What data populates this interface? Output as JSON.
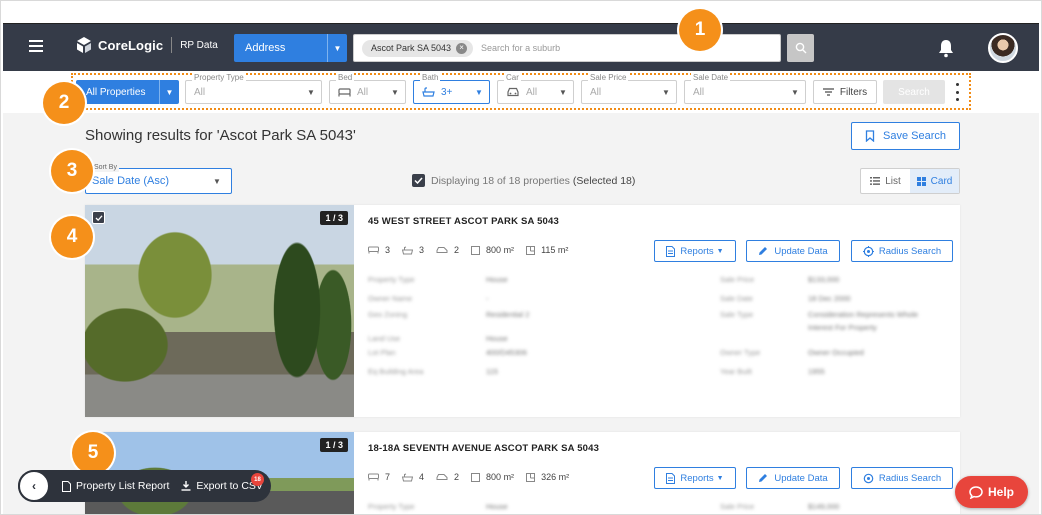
{
  "topnav": {
    "brand": "CoreLogic",
    "product": "RP Data",
    "address_select": "Address",
    "search_chip": "Ascot Park SA 5043",
    "search_placeholder": "Search for a suburb"
  },
  "filters": {
    "all_properties": "All Properties",
    "property_type": {
      "label": "Property Type",
      "value": "All"
    },
    "bed": {
      "label": "Bed",
      "value": "All"
    },
    "bath": {
      "label": "Bath",
      "value": "3+"
    },
    "car": {
      "label": "Car",
      "value": "All"
    },
    "sale_price": {
      "label": "Sale Price",
      "value": "All"
    },
    "sale_date": {
      "label": "Sale Date",
      "value": "All"
    },
    "filters_button": "Filters",
    "search_button": "Search"
  },
  "results": {
    "title": "Showing results for 'Ascot Park SA 5043'",
    "save_search": "Save Search",
    "sort_label": "Sort By",
    "sort_value": "Sale Date (Asc)",
    "displaying": "Displaying 18 of 18 properties",
    "selected": "(Selected 18)",
    "view_list": "List",
    "view_card": "Card"
  },
  "cards": [
    {
      "counter": "1 / 3",
      "address": "45 WEST STREET ASCOT PARK SA 5043",
      "beds": "3",
      "baths": "3",
      "cars": "2",
      "land": "800 m²",
      "floor": "115 m²",
      "reports": "Reports",
      "update": "Update Data",
      "radius": "Radius Search",
      "details": [
        [
          "Property Type",
          "House",
          "Sale Price",
          "$133,000"
        ],
        [
          "Owner Name",
          "-",
          "Sale Date",
          "18 Dec 2000"
        ],
        [
          "Geo Zoning",
          "Residential 2",
          "Sale Type",
          "Consideration Represents Whole"
        ],
        [
          "",
          "",
          "",
          "Interest For Property"
        ],
        [
          "Land Use",
          "House",
          "",
          ""
        ],
        [
          "Lot Plan",
          "400/D45306",
          "Owner Type",
          "Owner Occupied"
        ],
        [
          "Eq Building Area",
          "115",
          "Year Built",
          "1955"
        ]
      ]
    },
    {
      "counter": "1 / 3",
      "address": "18-18A SEVENTH AVENUE ASCOT PARK SA 5043",
      "beds": "7",
      "baths": "4",
      "cars": "2",
      "land": "800 m²",
      "floor": "326 m²",
      "reports": "Reports",
      "update": "Update Data",
      "radius": "Radius Search",
      "details": [
        [
          "Property Type",
          "House",
          "Sale Price",
          "$149,000"
        ]
      ]
    }
  ],
  "bottombar": {
    "report": "Property List Report",
    "export": "Export to CSV",
    "export_count": "18"
  },
  "help": "Help",
  "badges": [
    "1",
    "2",
    "3",
    "4",
    "5"
  ]
}
